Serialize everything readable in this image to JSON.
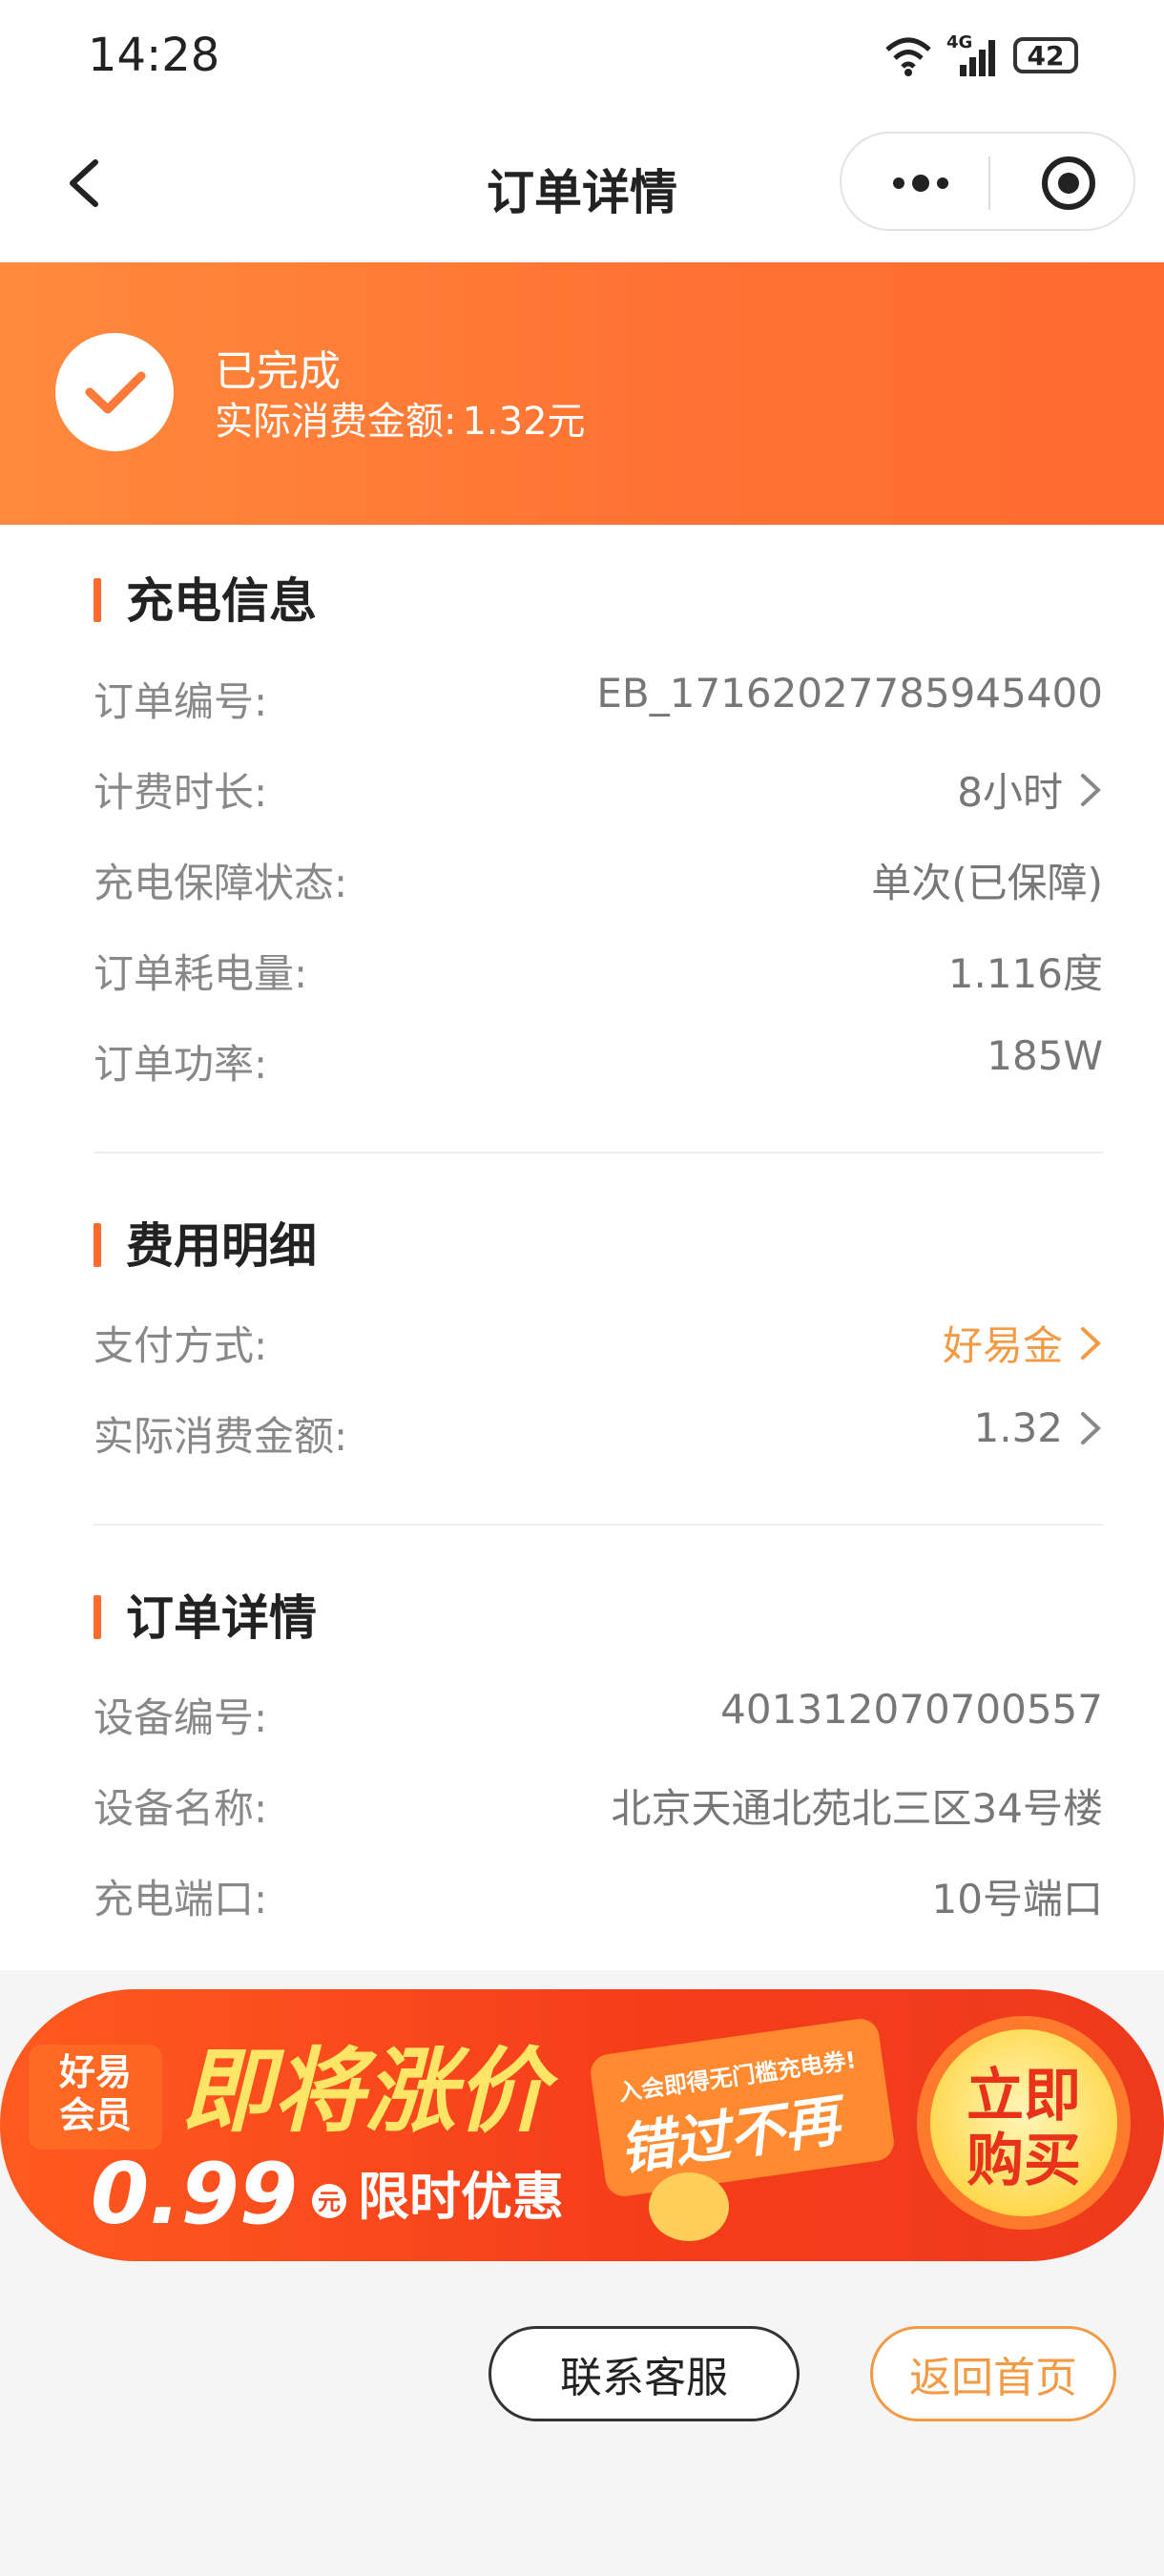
{
  "status_bar": {
    "time": "14:28",
    "battery": "42",
    "network": "4G"
  },
  "nav": {
    "title": "订单详情"
  },
  "banner": {
    "status": "已完成",
    "amount_label": "实际消费金额:",
    "amount_value": "1.32元"
  },
  "charge_info": {
    "title": "充电信息",
    "rows": [
      {
        "label": "订单编号:",
        "value": "EB_17162027785945400"
      },
      {
        "label": "计费时长:",
        "value": "8小时"
      },
      {
        "label": "充电保障状态:",
        "value": "单次(已保障)"
      },
      {
        "label": "订单耗电量:",
        "value": "1.116度"
      },
      {
        "label": "订单功率:",
        "value": "185W"
      }
    ]
  },
  "fee_detail": {
    "title": "费用明细",
    "rows": [
      {
        "label": "支付方式:",
        "value": "好易金"
      },
      {
        "label": "实际消费金额:",
        "value": "1.32"
      }
    ]
  },
  "order_detail": {
    "title": "订单详情",
    "rows": [
      {
        "label": "设备编号:",
        "value": "401312070700557"
      },
      {
        "label": "设备名称:",
        "value": "北京天通北苑北三区34号楼"
      },
      {
        "label": "充电端口:",
        "value": "10号端口"
      }
    ]
  },
  "promo": {
    "member_line1": "好易",
    "member_line2": "会员",
    "headline": "即将涨价",
    "price": "0.99",
    "price_unit": "元",
    "offer": "限时优惠",
    "tag_line1": "入会即得无门槛充电券!",
    "tag_line2": "错过不再",
    "cta_line1": "立即",
    "cta_line2": "购买"
  },
  "buttons": {
    "service": "联系客服",
    "home": "返回首页"
  },
  "colors": {
    "accent": "#ff6a2d",
    "link_orange": "#f39a45"
  }
}
